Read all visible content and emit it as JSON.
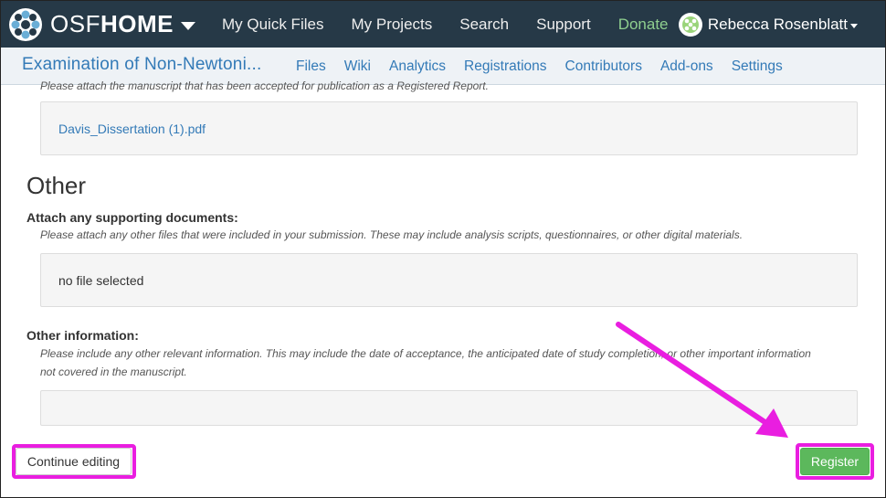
{
  "topnav": {
    "brand_prefix": "OSF",
    "brand_suffix": "HOME",
    "links": {
      "quick_files": "My Quick Files",
      "projects": "My Projects",
      "search": "Search",
      "support": "Support",
      "donate": "Donate"
    },
    "user_name": "Rebecca Rosenblatt"
  },
  "subnav": {
    "project_title": "Examination of Non-Newtoni...",
    "tabs": {
      "files": "Files",
      "wiki": "Wiki",
      "analytics": "Analytics",
      "registrations": "Registrations",
      "contributors": "Contributors",
      "addons": "Add-ons",
      "settings": "Settings"
    }
  },
  "content": {
    "cut_off_help": "Please attach the manuscript that has been accepted for publication as a Registered Report.",
    "manuscript_file": "Davis_Dissertation (1).pdf",
    "section_title": "Other",
    "supporting_docs": {
      "label": "Attach any supporting documents:",
      "help": "Please attach any other files that were included in your submission. These may include analysis scripts, questionnaires, or other digital materials.",
      "value": "no file selected"
    },
    "other_info": {
      "label": "Other information:",
      "help": "Please include any other relevant information. This may include the date of acceptance, the anticipated date of study completion, or other important information not covered in the manuscript.",
      "value": ""
    }
  },
  "actions": {
    "continue_editing": "Continue editing",
    "register": "Register"
  },
  "colors": {
    "topnav_bg": "#263947",
    "link_blue": "#337ab7",
    "register_green": "#5cb85c",
    "highlight_magenta": "#e91ee0",
    "donate_green": "#8fcf8f"
  },
  "icons": {
    "brand_logo": "osf-logo-icon",
    "brand_menu": "chevron-down-icon",
    "user_avatar": "avatar-icon",
    "user_menu": "caret-down-icon",
    "annotation": "arrow-icon"
  }
}
